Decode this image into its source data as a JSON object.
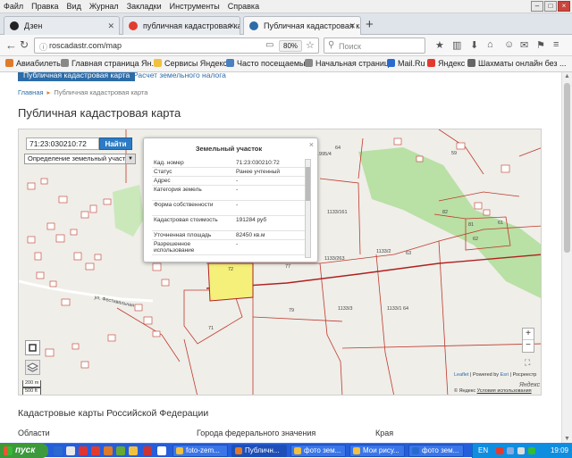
{
  "menubar": {
    "items": [
      "Файл",
      "Правка",
      "Вид",
      "Журнал",
      "Закладки",
      "Инструменты",
      "Справка"
    ]
  },
  "tabs": [
    {
      "label": "Дзен",
      "icon": "dzen-icon",
      "icon_color": "#222222",
      "active": false
    },
    {
      "label": "публичная кадастровая карта",
      "icon": "yandex-icon",
      "icon_color": "#e23b2e",
      "active": false
    },
    {
      "label": "Публичная кадастровая карта",
      "icon": "rosreestr-icon",
      "icon_color": "#2c6ca8",
      "active": true
    }
  ],
  "navbar": {
    "url": "roscadastr.com/map",
    "zoom": "80%",
    "search_placeholder": "Поиск"
  },
  "bookmarks": [
    {
      "label": "Авиабилеты",
      "color": "#e07a28"
    },
    {
      "label": "Главная страница Ян...",
      "color": "#888888"
    },
    {
      "label": "Сервисы Яндекса",
      "color": "#f0c040"
    },
    {
      "label": "Часто посещаемые",
      "color": "#4a7fc0"
    },
    {
      "label": "Начальная страница",
      "color": "#888888"
    },
    {
      "label": "Mail.Ru",
      "color": "#2a6ad0"
    },
    {
      "label": "Яндекс",
      "color": "#e23b2e"
    },
    {
      "label": "Шахматы онлайн без ...",
      "color": "#666666"
    }
  ],
  "page": {
    "subnav": {
      "active": "Публичная кадастровая карта",
      "other": "Расчет земельного налога"
    },
    "breadcrumb": {
      "home": "Главная",
      "current": "Публичная кадастровая карта"
    },
    "title": "Публичная кадастровая карта",
    "map": {
      "search_value": "71:23:030210:72",
      "find_label": "Найти",
      "type_select": "Определение земельный участок",
      "popup": {
        "title": "Земельный участок",
        "rows": [
          {
            "key": "Кад. номер",
            "value": "71:23:030210:72"
          },
          {
            "key": "Статус",
            "value": "Ранее учтенный"
          },
          {
            "key": "Адрес",
            "value": "-"
          },
          {
            "key": "Категория земель",
            "value": "-"
          },
          {
            "key": "Форма собственности",
            "value": "-"
          },
          {
            "key": "Кадастровая стоимость",
            "value": "191284 руб"
          },
          {
            "key": "Уточненная площадь",
            "value": "82450 кв.м"
          },
          {
            "key": "Разрешенное использование",
            "value": "-"
          }
        ]
      },
      "labels": [
        "1995/4",
        "64",
        "59",
        "1133/161",
        "82",
        "81",
        "62",
        "61",
        "77",
        "1133/263",
        "1133/2",
        "63",
        "79",
        "1133/3",
        "1133/1",
        "64",
        "71",
        "72",
        "ул. Фестивальная"
      ],
      "zoom_in": "+",
      "zoom_out": "−",
      "attribution": {
        "leaflet": "Leaflet",
        "powered": "| Powered by",
        "esri": "Esri",
        "rosreestr": "| Росреестр"
      },
      "yandex": "Яндекс",
      "terms": {
        "brand": "© Яндекс",
        "link": "Условия использования"
      },
      "scale": {
        "metric": "200 m",
        "imperial": "500 ft"
      }
    },
    "section_title": "Кадастровые карты Российской Федерации",
    "columns": [
      "Области",
      "Города федерального значения",
      "Края"
    ]
  },
  "taskbar": {
    "start": "пуск",
    "tasks": [
      {
        "label": "foto-zem...",
        "color": "#f0c040",
        "active": false
      },
      {
        "label": "Публичн...",
        "color": "#e07a28",
        "active": true
      },
      {
        "label": "фото зем...",
        "color": "#f0c040",
        "active": false
      },
      {
        "label": "Мои рису...",
        "color": "#f0c040",
        "active": false
      },
      {
        "label": "фото зем...",
        "color": "#2a6ad0",
        "active": false
      }
    ],
    "lang": "EN",
    "clock": "19:09"
  },
  "colors": {
    "accent": "#2c6ca8",
    "parcel_highlight": "#f5f07a",
    "parcel_border": "#c0392b",
    "forest": "#b9e0a5"
  }
}
